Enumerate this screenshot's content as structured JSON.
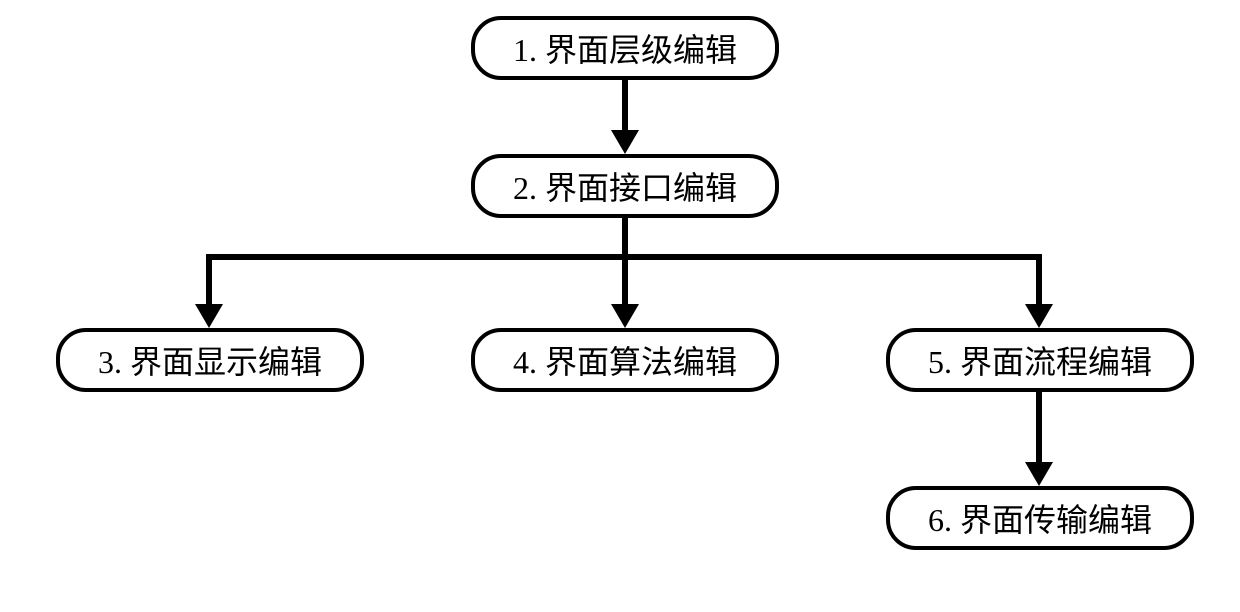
{
  "diagram": {
    "nodes": {
      "n1": {
        "label": "1. 界面层级编辑"
      },
      "n2": {
        "label": "2. 界面接口编辑"
      },
      "n3": {
        "label": "3. 界面显示编辑"
      },
      "n4": {
        "label": "4. 界面算法编辑"
      },
      "n5": {
        "label": "5. 界面流程编辑"
      },
      "n6": {
        "label": "6. 界面传输编辑"
      }
    },
    "edges": [
      {
        "from": "n1",
        "to": "n2"
      },
      {
        "from": "n2",
        "to": "n3"
      },
      {
        "from": "n2",
        "to": "n4"
      },
      {
        "from": "n2",
        "to": "n5"
      },
      {
        "from": "n5",
        "to": "n6"
      }
    ]
  }
}
